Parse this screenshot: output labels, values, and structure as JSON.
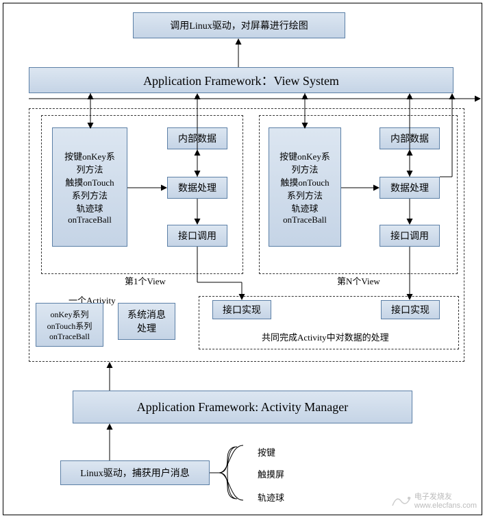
{
  "top_box": "调用Linux驱动，对屏幕进行绘图",
  "view_system": "Application Framework：View System",
  "view_block": {
    "handlers": "按键onKey系\n列方法\n触摸onTouch\n系列方法\n轨迹球\nonTraceBall",
    "internal_data": "内部数据",
    "data_process": "数据处理",
    "interface_call": "接口调用"
  },
  "view1_label": "第1个View",
  "viewN_label": "第N个View",
  "activity_label": "一个Activity",
  "activity_handlers": "onKey系列\nonTouch系列\nonTraceBall",
  "sys_msg": "系统消息\n处理",
  "interface_impl": "接口实现",
  "shared_label": "共同完成Activity中对数据的处理",
  "activity_manager": "Application Framework: Activity Manager",
  "linux_driver_user": "Linux驱动，捕获用户消息",
  "inputs": {
    "key": "按键",
    "touch": "触摸屏",
    "track": "轨迹球"
  },
  "wm_text": "电子发烧友",
  "wm_url": "www.elecfans.com"
}
